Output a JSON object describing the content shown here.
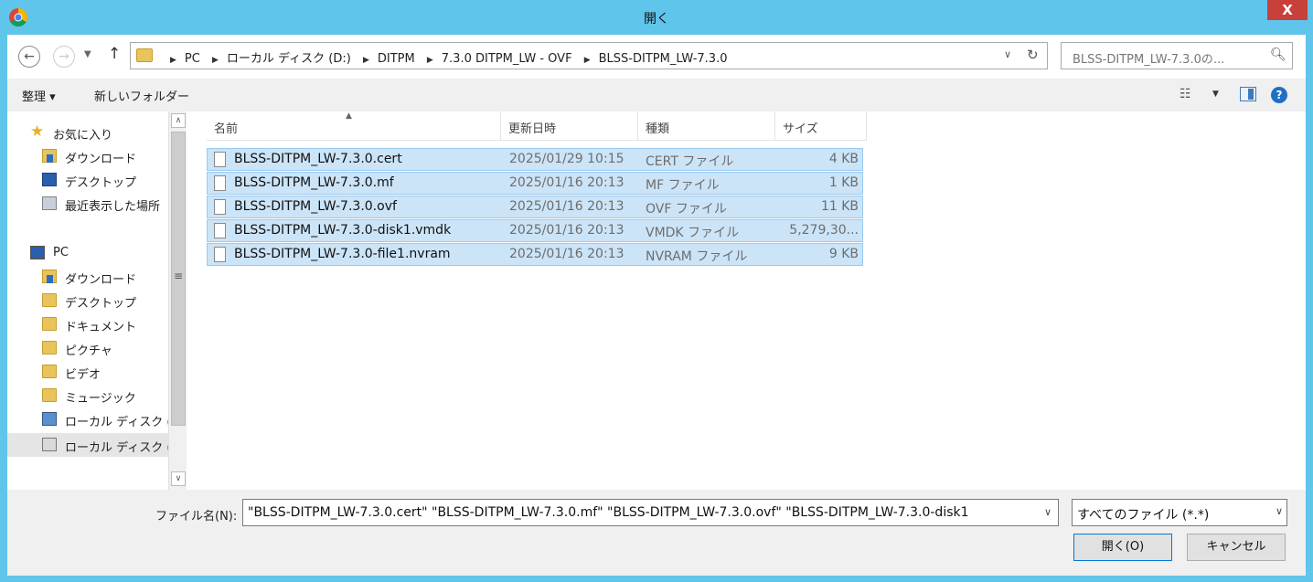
{
  "window": {
    "title": "開く",
    "close_label": "X"
  },
  "address": {
    "crumbs": [
      "PC",
      "ローカル ディスク (D:)",
      "DITPM",
      "7.3.0 DITPM_LW - OVF",
      "BLSS-DITPM_LW-7.3.0"
    ]
  },
  "search": {
    "placeholder": "BLSS-DITPM_LW-7.3.0の..."
  },
  "toolbar": {
    "organize_label": "整理 ▾",
    "new_folder_label": "新しいフォルダー"
  },
  "nav": {
    "items": [
      {
        "label": "お気に入り",
        "icon": "star-icon"
      },
      {
        "label": "ダウンロード",
        "icon": "downloads-folder-icon"
      },
      {
        "label": "デスクトップ",
        "icon": "desktop-icon"
      },
      {
        "label": "最近表示した場所",
        "icon": "recent-places-icon"
      },
      {
        "label": "PC",
        "icon": "computer-icon"
      },
      {
        "label": "ダウンロード",
        "icon": "downloads-folder-icon"
      },
      {
        "label": "デスクトップ",
        "icon": "desktop-folder-icon"
      },
      {
        "label": "ドキュメント",
        "icon": "documents-folder-icon"
      },
      {
        "label": "ピクチャ",
        "icon": "pictures-folder-icon"
      },
      {
        "label": "ビデオ",
        "icon": "videos-folder-icon"
      },
      {
        "label": "ミュージック",
        "icon": "music-folder-icon"
      },
      {
        "label": "ローカル ディスク (C",
        "icon": "drive-icon"
      },
      {
        "label": "ローカル ディスク (D",
        "icon": "drive-icon"
      }
    ]
  },
  "columns": {
    "name": "名前",
    "modified": "更新日時",
    "type": "種類",
    "size": "サイズ"
  },
  "files": [
    {
      "name": "BLSS-DITPM_LW-7.3.0.cert",
      "modified": "2025/01/29 10:15",
      "type": "CERT ファイル",
      "size": "4 KB"
    },
    {
      "name": "BLSS-DITPM_LW-7.3.0.mf",
      "modified": "2025/01/16 20:13",
      "type": "MF ファイル",
      "size": "1 KB"
    },
    {
      "name": "BLSS-DITPM_LW-7.3.0.ovf",
      "modified": "2025/01/16 20:13",
      "type": "OVF ファイル",
      "size": "11 KB"
    },
    {
      "name": "BLSS-DITPM_LW-7.3.0-disk1.vmdk",
      "modified": "2025/01/16 20:13",
      "type": "VMDK ファイル",
      "size": "5,279,30..."
    },
    {
      "name": "BLSS-DITPM_LW-7.3.0-file1.nvram",
      "modified": "2025/01/16 20:13",
      "type": "NVRAM ファイル",
      "size": "9 KB"
    }
  ],
  "filename": {
    "label": "ファイル名(N):",
    "value": "\"BLSS-DITPM_LW-7.3.0.cert\" \"BLSS-DITPM_LW-7.3.0.mf\" \"BLSS-DITPM_LW-7.3.0.ovf\" \"BLSS-DITPM_LW-7.3.0-disk1"
  },
  "filter": {
    "value": "すべてのファイル (*.*)"
  },
  "buttons": {
    "open_label": "開く(O)",
    "cancel_label": "キャンセル"
  }
}
